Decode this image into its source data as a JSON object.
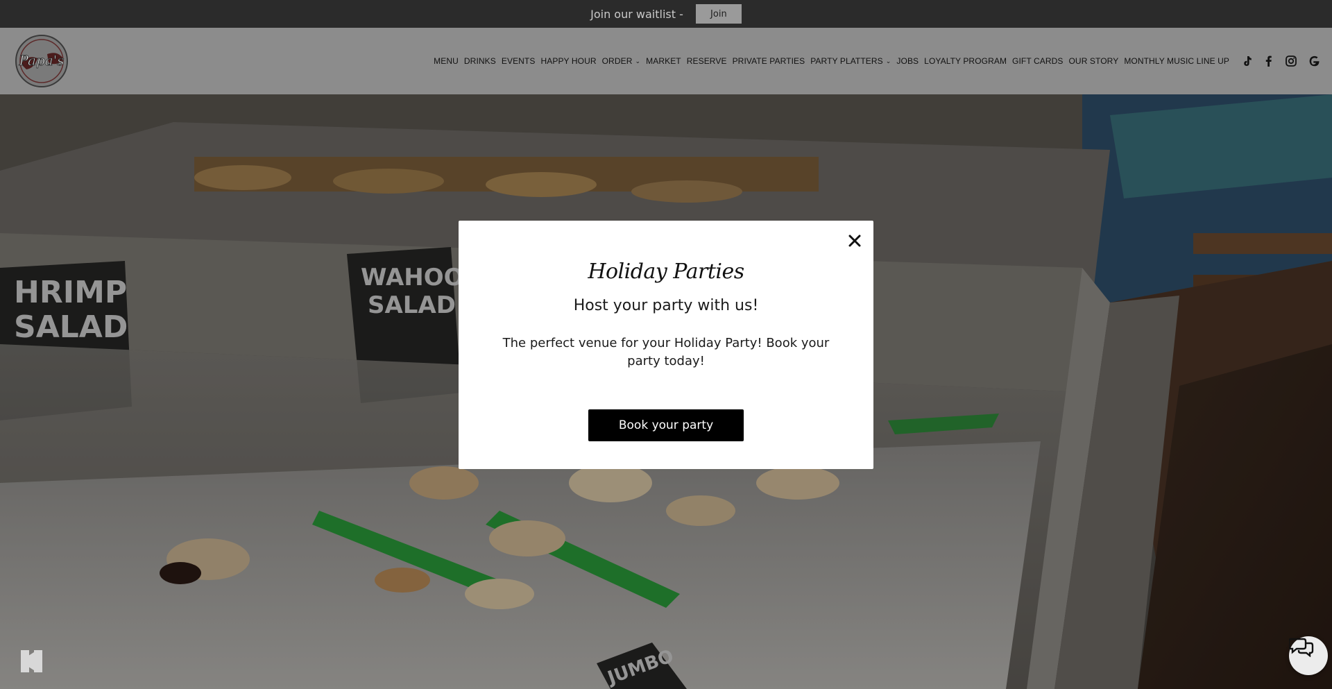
{
  "topbar": {
    "text": "Join our waitlist -",
    "join_label": "Join"
  },
  "header": {
    "logo_alt": "Papa's",
    "nav": [
      {
        "label": "MENU"
      },
      {
        "label": "DRINKS"
      },
      {
        "label": "EVENTS"
      },
      {
        "label": "HAPPY HOUR"
      },
      {
        "label": "ORDER",
        "dropdown": true
      },
      {
        "label": "MARKET"
      },
      {
        "label": "RESERVE"
      },
      {
        "label": "PRIVATE PARTIES"
      },
      {
        "label": "PARTY PLATTERS",
        "dropdown": true
      },
      {
        "label": "JOBS"
      },
      {
        "label": "LOYALTY PROGRAM"
      },
      {
        "label": "GIFT CARDS"
      },
      {
        "label": "OUR STORY"
      },
      {
        "label": "MONTHLY MUSIC LINE UP"
      }
    ],
    "social": [
      "tiktok-icon",
      "facebook-icon",
      "instagram-icon",
      "google-icon"
    ]
  },
  "hero": {
    "sign_texts": [
      "HRIMP",
      "SALAD",
      "WAHOO",
      "SALAD",
      "JUMBO"
    ]
  },
  "modal": {
    "title": "Holiday Parties",
    "subtitle": "Host your party with us!",
    "body": "The perfect venue for your Holiday Party! Book your party today!",
    "button_label": "Book your party"
  },
  "colors": {
    "topbar_bg": "#2b2b2b",
    "header_bg": "#8c8c8c",
    "modal_bg": "#ffffff",
    "button_bg": "#000000"
  }
}
